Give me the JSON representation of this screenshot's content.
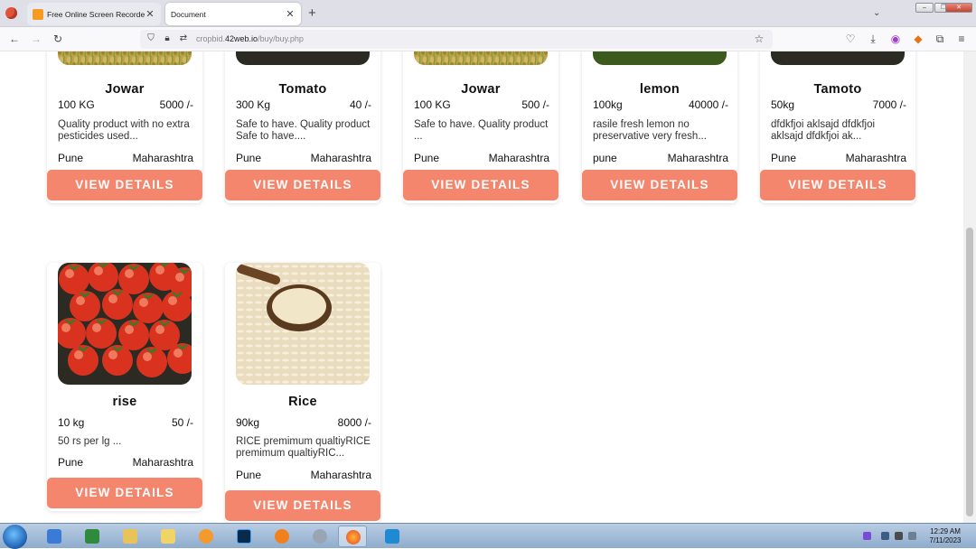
{
  "browser": {
    "tabs": [
      {
        "title": "Free Online Screen Recorder &",
        "active": false
      },
      {
        "title": "Document",
        "active": true
      }
    ],
    "url_prefix": "cropbid.",
    "url_host": "42web.io",
    "url_path": "/buy/buy.php"
  },
  "window_controls": {
    "minimize": "–",
    "restore": "❐",
    "close": "✕"
  },
  "products": [
    {
      "name": "Jowar",
      "quantity": "100 KG",
      "price": "5000 /-",
      "description": "Quality product with no extra pesticides used...",
      "city": "Pune",
      "state": "Maharashtra",
      "button": "VIEW DETAILS",
      "image": "grain-icon"
    },
    {
      "name": "Tomato",
      "quantity": "300 Kg",
      "price": "40 /-",
      "description": "Safe to have. Quality product Safe to have....",
      "city": "Pune",
      "state": "Maharashtra",
      "button": "VIEW DETAILS",
      "image": "tomato-icon"
    },
    {
      "name": "Jowar",
      "quantity": "100 KG",
      "price": "500 /-",
      "description": "Safe to have. Quality product ...",
      "city": "Pune",
      "state": "Maharashtra",
      "button": "VIEW DETAILS",
      "image": "grain-icon"
    },
    {
      "name": "lemon",
      "quantity": "100kg",
      "price": "40000 /-",
      "description": "rasile fresh lemon no preservative very fresh...",
      "city": "pune",
      "state": "Maharashtra",
      "button": "VIEW DETAILS",
      "image": "lemon-icon"
    },
    {
      "name": "Tamoto",
      "quantity": "50kg",
      "price": "7000 /-",
      "description": "dfdkfjoi aklsajd dfdkfjoi aklsajd dfdkfjoi ak...",
      "city": "Pune",
      "state": "Maharashtra",
      "button": "VIEW DETAILS",
      "image": "tomato-icon"
    },
    {
      "name": "rise",
      "quantity": "10 kg",
      "price": "50 /-",
      "description": "50 rs per lg ...",
      "city": "Pune",
      "state": "Maharashtra",
      "button": "VIEW DETAILS",
      "image": "tomato-icon"
    },
    {
      "name": "Rice",
      "quantity": "90kg",
      "price": "8000 /-",
      "description": "RICE premimum qualtiyRICE premimum qualtiyRIC...",
      "city": "Pune",
      "state": "Maharashtra",
      "button": "VIEW DETAILS",
      "image": "rice-icon"
    }
  ],
  "taskbar": {
    "time": "12:29 AM",
    "date": "7/11/2023"
  }
}
